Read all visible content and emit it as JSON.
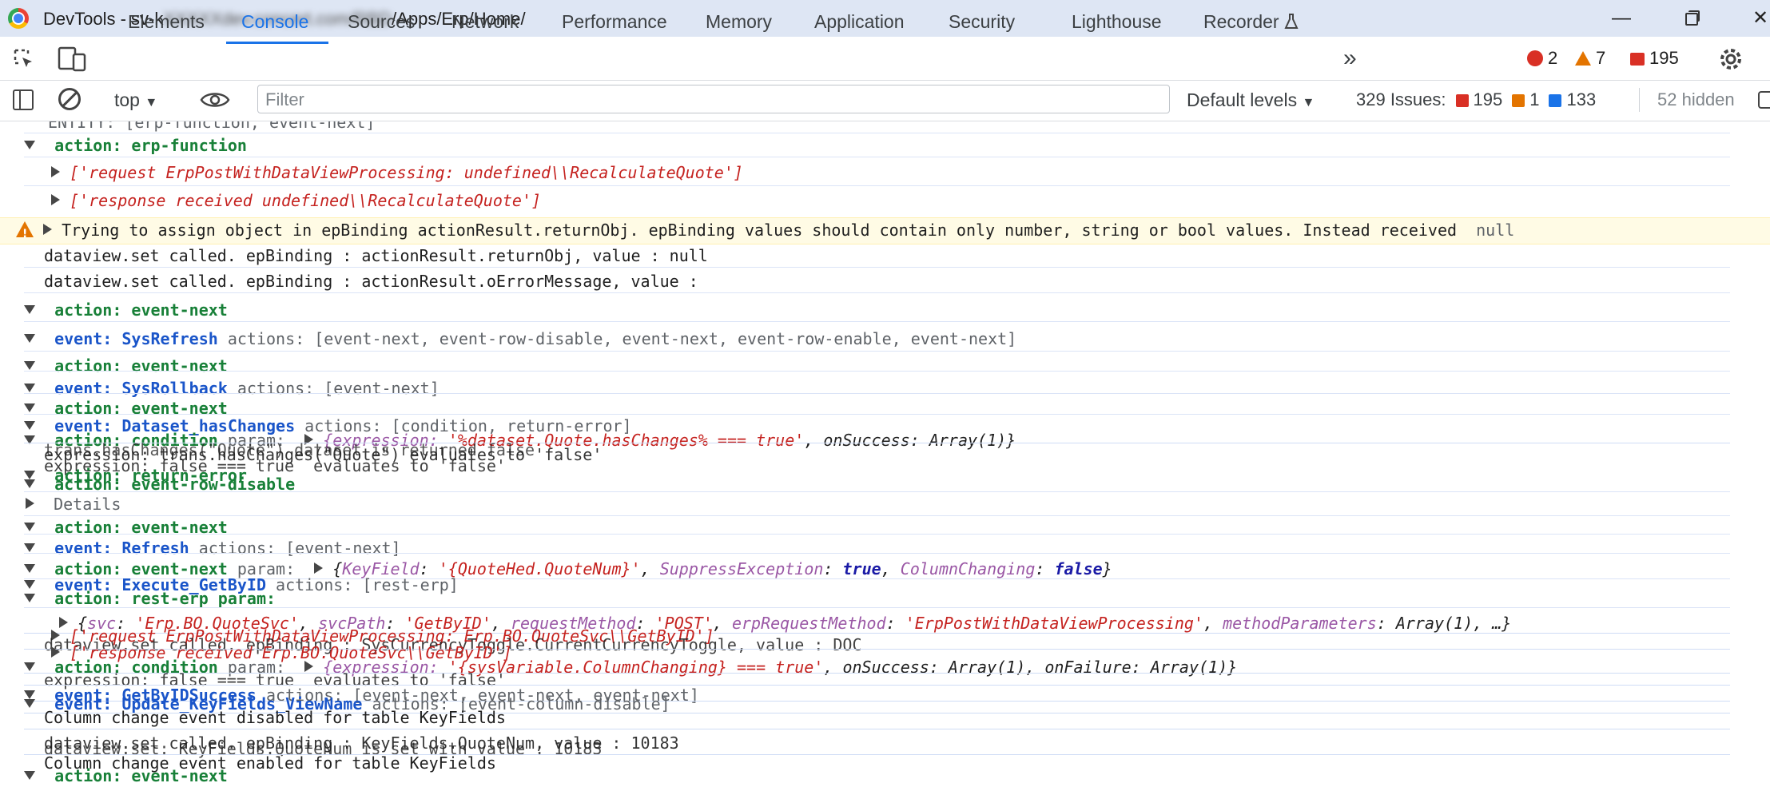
{
  "window": {
    "title_prefix": "DevTools - sv-k",
    "title_hidden": "XXXXXdev.concert.com/RBD",
    "title_suffix": "/Apps/Erp/Home/",
    "minimize_glyph": "—",
    "close_glyph": "✕"
  },
  "tabs": [
    "Elements",
    "Console",
    "Sources",
    "Network",
    "Performance",
    "Memory",
    "Application",
    "Security",
    "Lighthouse",
    "Recorder"
  ],
  "active_tab": "Console",
  "counters": {
    "errors": "2",
    "warnings": "7",
    "issues": "195"
  },
  "toolbar": {
    "context": "top",
    "filter_placeholder": "Filter",
    "levels": "Default levels",
    "issues_label": "329 Issues:",
    "issues_errors": "195",
    "issues_warnings": "1",
    "issues_info": "133",
    "hidden": "52 hidden"
  },
  "colors": {
    "accent": "#1a73e8",
    "error": "#d93025",
    "warning": "#e37400",
    "group_green": "#188038",
    "event_blue": "#1a55c9"
  },
  "console": {
    "l0": "ENTITY: [erp-function, event-next]",
    "l1a": "action: erp-function",
    "l2a": "['request ErpPostWithDataViewProcessing: undefined\\\\RecalculateQuote']",
    "l3a": "['response received undefined\\\\RecalculateQuote']",
    "warn": "Trying to assign object in epBinding actionResult.returnObj. epBinding values should contain only number, string or bool values. Instead received",
    "warn_null": "null",
    "l5": "dataview.set called. epBinding : actionResult.returnObj, value : null",
    "l6": "dataview.set called. epBinding : actionResult.oErrorMessage, value :",
    "l7": "action: event-next",
    "l8_event": "event: SysRefresh",
    "l8_actions": "actions: [event-next, event-row-disable, event-next, event-row-enable, event-next]",
    "l9": "action: event-next",
    "l10_event": "event: SysRollback",
    "l10_actions": "actions: [event-next]",
    "l11": "action: event-next",
    "l12_event": "event: Dataset_hasChanges",
    "l12_actions": "actions: [condition, return-error]",
    "l13_action": "action: condition",
    "l13_param": "param:",
    "l13_obj_open": "{expression:",
    "l13_expr": "'%dataset.Quote.hasChanges% === true'",
    "l13_rest": ", onSuccess: Array(1)}",
    "l14a": "expression: trans.hasChanges(\"Quote\") evaluates to 'false'",
    "l14b": "trans.hasChanges(\"Quote\") dataset is returned false",
    "l15a": "expression: false === true  evaluates to 'false'",
    "l16a": "action: return-error",
    "l16b": "action: event-row-disable",
    "l17": "Details",
    "l18": "action: event-next",
    "l19_event": "event: Refresh",
    "l19_actions": "actions: [event-next]",
    "l20_action": "action: event-next",
    "l20_param": "param:",
    "l20_k1": "KeyField",
    "l20_v1": "'{QuoteHed.QuoteNum}'",
    "l20_k2": "SuppressException",
    "l20_v2": "true",
    "l20_k3": "ColumnChanging",
    "l20_v3": "false",
    "l21_event": "event: Execute_GetByID",
    "l21_actions": "actions: [rest-erp]",
    "l22": "action: rest-erp param:",
    "l23_k1": "svc",
    "l23_v1": "'Erp.BO.QuoteSvc'",
    "l23_k2": "svcPath",
    "l23_v2": "'GetByID'",
    "l23_k3": "requestMethod",
    "l23_v3": "'POST'",
    "l23_k4": "erpRequestMethod",
    "l23_v4": "'ErpPostWithDataViewProcessing'",
    "l23_k5": "methodParameters",
    "l23_v5": "Array(1), …}",
    "l24a": "['request ErpPostWithDataViewProcessing: Erp.BO.QuoteSvc\\\\GetByID']",
    "l24b": "dataview.set called. epBinding : SysCurrencyToggle.CurrentCurrencyToggle, value : DOC",
    "l25a": "['response received Erp.BO.QuoteSvc\\\\GetByID']",
    "l26_action": "action: condition",
    "l26_param": "param:",
    "l26_expr": "'{sysVariable.ColumnChanging} === true'",
    "l26_rest": ", onSuccess: Array(1), onFailure: Array(1)}",
    "l27a": "expression: false === true  evaluates to 'false'",
    "l28_event": "event: GetByIDSuccess",
    "l28_actions": "actions: [event-next, event-next, event-next]",
    "l29_event": "event: Update_KeyFields_ViewName",
    "l29_actions": "actions: [event-column-disable]",
    "l30a": "Column change event disabled for table KeyFields",
    "l31a": "dataview.set called. epBinding : KeyFields.QuoteNum, value : 10183",
    "l31b": "dataview.set: KeyFields.QuoteNum is set with value : 10183",
    "l32a": "Column change event enabled for table KeyFields",
    "l33a": "action: event-next"
  }
}
